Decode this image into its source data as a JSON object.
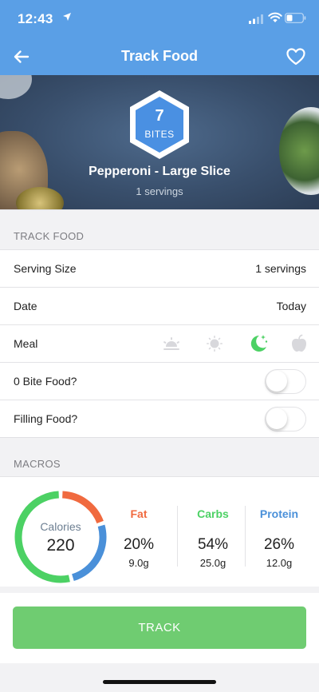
{
  "status": {
    "time": "12:43"
  },
  "header": {
    "title": "Track Food"
  },
  "food": {
    "bites_value": "7",
    "bites_label": "BITES",
    "name": "Pepperoni - Large Slice",
    "servings": "1 servings"
  },
  "track_food": {
    "section_label": "TRACK FOOD",
    "serving_size_label": "Serving Size",
    "serving_size_value": "1 servings",
    "date_label": "Date",
    "date_value": "Today",
    "meal_label": "Meal",
    "meal_options": [
      "sunrise-icon",
      "sun-icon",
      "moon-stars-icon",
      "apple-icon"
    ],
    "meal_selected": "moon-stars-icon",
    "zero_bite_label": "0 Bite Food?",
    "zero_bite_on": false,
    "filling_label": "Filling Food?",
    "filling_on": false
  },
  "macros": {
    "section_label": "MACROS",
    "calories_label": "Calories",
    "calories_value": "220",
    "items": [
      {
        "name": "Fat",
        "percent": "20%",
        "grams": "9.0g",
        "color": "#f06a3f"
      },
      {
        "name": "Carbs",
        "percent": "54%",
        "grams": "25.0g",
        "color": "#4cd164"
      },
      {
        "name": "Protein",
        "percent": "26%",
        "grams": "12.0g",
        "color": "#4a90d9"
      }
    ]
  },
  "actions": {
    "track_label": "TRACK"
  },
  "colors": {
    "header": "#5a9fe6",
    "track_button": "#6fcc71",
    "selected_meal": "#4cd164",
    "inactive_icon": "#d8d8dc"
  }
}
